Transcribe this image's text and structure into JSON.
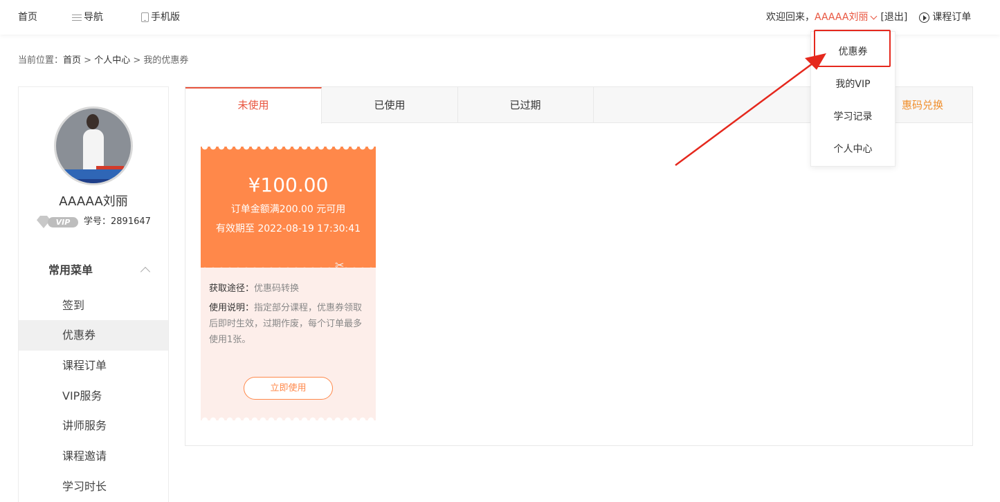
{
  "topbar": {
    "home": "首页",
    "guide": "导航",
    "mobile": "手机版",
    "welcome": "欢迎回来，",
    "username": "AAAAA刘丽",
    "logout": "[退出]",
    "orders": "课程订单"
  },
  "breadcrumb": {
    "prefix": "当前位置：",
    "items": [
      "首页",
      "个人中心",
      "我的优惠券"
    ],
    "separator": " > "
  },
  "sidebar": {
    "name": "AAAAA刘丽",
    "vip_label": "VIP",
    "student_id": "学号：2891647",
    "section_title": "常用菜单",
    "items": [
      {
        "label": "签到",
        "active": false
      },
      {
        "label": "优惠券",
        "active": true
      },
      {
        "label": "课程订单",
        "active": false
      },
      {
        "label": "VIP服务",
        "active": false
      },
      {
        "label": "讲师服务",
        "active": false
      },
      {
        "label": "课程邀请",
        "active": false
      },
      {
        "label": "学习时长",
        "active": false
      }
    ]
  },
  "tabs": [
    {
      "label": "未使用",
      "active": true
    },
    {
      "label": "已使用",
      "active": false
    },
    {
      "label": "已过期",
      "active": false
    }
  ],
  "redeem_label": "惠码兑换",
  "coupon": {
    "amount": "¥100.00",
    "condition": "订单金额满200.00 元可用",
    "expiry": "有效期至 2022-08-19 17:30:41",
    "source_label": "获取途径：",
    "source_value": "优惠码转换",
    "usage_label": "使用说明：",
    "usage_value": "指定部分课程，优惠券领取后即时生效，过期作废，每个订单最多使用1张。",
    "use_button": "立即使用"
  },
  "dropdown": {
    "items": [
      "优惠券",
      "我的VIP",
      "学习记录",
      "个人中心"
    ]
  },
  "colors": {
    "accent": "#e8533d",
    "coupon_orange": "#ff884a",
    "annotation_red": "#e5281d"
  }
}
